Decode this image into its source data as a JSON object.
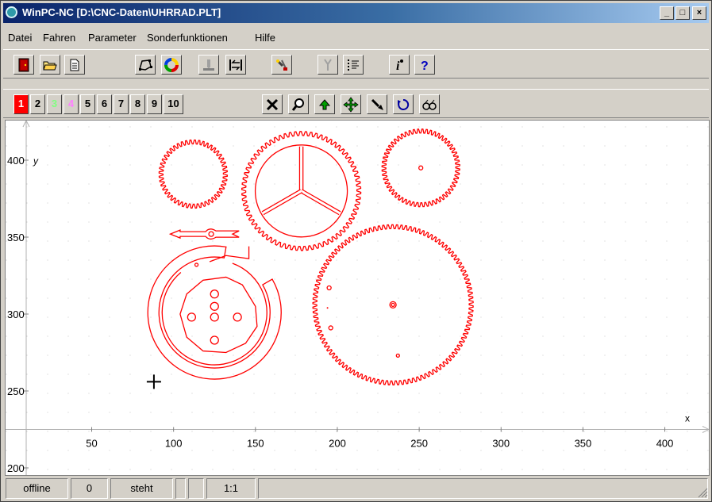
{
  "window": {
    "title": "WinPC-NC [D:\\CNC-Daten\\UHRRAD.PLT]"
  },
  "title_buttons": {
    "minimize": "_",
    "maximize": "□",
    "close": "×"
  },
  "menu": [
    "Datei",
    "Fahren",
    "Parameter",
    "Sonderfunktionen",
    "Hilfe"
  ],
  "toolbar1_icons": [
    "exit-door-icon",
    "open-folder-icon",
    "document-icon",
    "polygon-icon",
    "color-wheel-icon",
    "machine-icon",
    "swap-icon",
    "tools-icon",
    "tool-change-icon",
    "list-icon",
    "info-icon",
    "help-icon"
  ],
  "layers": {
    "labels": [
      "1",
      "2",
      "3",
      "4",
      "5",
      "6",
      "7",
      "8",
      "9",
      "10"
    ],
    "colors": [
      "#ffffff",
      "#000000",
      "#80ff80",
      "#ff80ff",
      "#000000",
      "#000000",
      "#000000",
      "#000000",
      "#000000",
      "#000000"
    ],
    "active_index": 0
  },
  "toolbar2_icons": [
    "clear-icon",
    "zoom-icon",
    "up-arrow-icon",
    "move-icon",
    "pointer-icon",
    "refresh-icon",
    "preview-glasses-icon"
  ],
  "plot": {
    "x_label": "x",
    "y_label": "y",
    "x_ticks": [
      "50",
      "100",
      "150",
      "200",
      "250",
      "300",
      "350",
      "400"
    ],
    "y_ticks": [
      "400",
      "350",
      "300",
      "250",
      "200"
    ],
    "stroke_color": "#ff0000"
  },
  "status": [
    "offline",
    "0",
    "steht",
    "",
    "",
    "1:1",
    ""
  ]
}
